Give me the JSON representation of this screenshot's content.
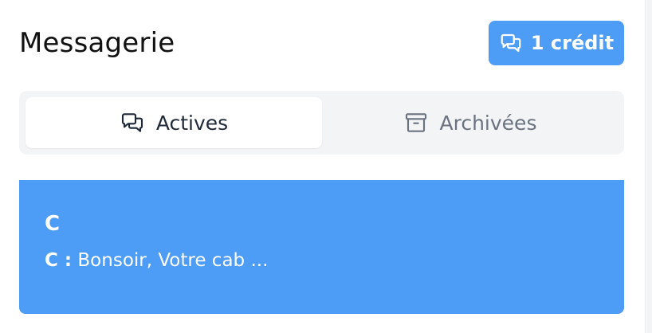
{
  "header": {
    "title": "Messagerie",
    "credit_label": "1 crédit"
  },
  "tabs": [
    {
      "label": "Actives",
      "icon": "chat-bubbles-icon",
      "active": true
    },
    {
      "label": "Archivées",
      "icon": "archive-box-icon",
      "active": false
    }
  ],
  "conversations": [
    {
      "name": "C",
      "sender": "C :",
      "preview": "Bonsoir, Votre cab ..."
    }
  ],
  "colors": {
    "accent": "#4d9cf5",
    "tab_bg": "#f3f4f6",
    "text_dark": "#111111",
    "text_muted": "#6b7280"
  }
}
